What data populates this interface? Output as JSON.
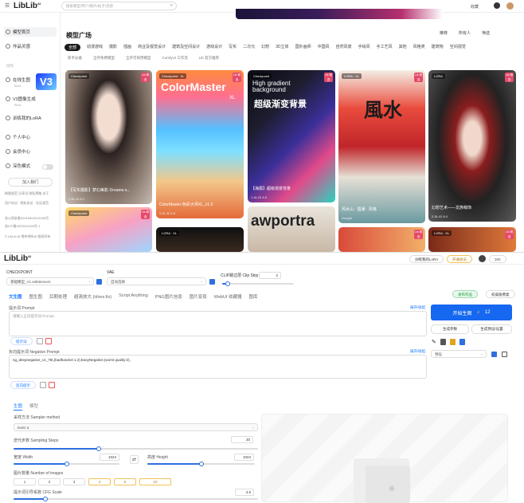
{
  "top": {
    "logo": "LibLib",
    "logo_sup": "AI",
    "search_placeholder": "搜索模型/用户/图片/帖子/灵感",
    "topbar_right": [
      "收藏",
      "登录"
    ],
    "sidebar": {
      "items": [
        {
          "label": "模型首页",
          "active": true
        },
        {
          "label": "作品灵感",
          "active": false
        }
      ],
      "group_label": "创作",
      "create_items": [
        {
          "label": "在线生图",
          "sub": "Beta"
        },
        {
          "label": "V3图像生成",
          "sub": "Beta"
        },
        {
          "label": "训练我的LoRA",
          "sub": ""
        }
      ],
      "user_items": [
        "个人中心",
        "会员中心",
        "深色模式"
      ],
      "join_button": "加入我们",
      "footer_lines": [
        "刷图规范 分享设 隐私策略 关于",
        "用户协议 · 隐私协议 · 社区规范",
        "浙公网安备33010602012345号",
        "浙ICP备2023012345号-1",
        "© LibLib AI 哩布哩布AI 版权所有"
      ],
      "v3_label": "V3"
    },
    "section_title": "模型广场",
    "tabs": [
      "全部",
      "动漫游戏",
      "摄影",
      "插画",
      "商业及视觉设计",
      "建筑及空间设计",
      "游戏设计",
      "写实",
      "二次元",
      "幻想",
      "3D立体",
      "国外画师",
      "中国风",
      "自然风景",
      "手绘风",
      "手工艺风",
      "其他",
      "风格类",
      "建筑物",
      "空间视觉"
    ],
    "filters": [
      "新手必备",
      "全开免费模型",
      "全开可商用模型",
      "ComfyUI 工作流",
      "Lib 官方推荐"
    ],
    "sort": [
      "推荐",
      "所有人",
      "筛选"
    ],
    "cards": [
      {
        "badge": "Checkpoint",
        "title": "【写实摄影】梦幻美影-Dreams-s...",
        "meta": "1.5k  49  5.2"
      },
      {
        "badge": "Checkpoint · XL",
        "title": "ColorMaster-色彩大师XL_v1.0",
        "meta": "2.0k  30  4.8"
      },
      {
        "badge": "Checkpoint",
        "title": "【海报】超级渐变背景",
        "meta": "1.1k  22  4.6"
      },
      {
        "badge": "LORA · XL",
        "title": "风水山 · 国潮 · 风格",
        "meta": "Hongfa"
      },
      {
        "badge": "LORA",
        "title": "幻想艺术——龙族萌饰",
        "meta": "2.2k  41  5.0"
      }
    ],
    "card_overlays": {
      "colormaster": "ColorMaster",
      "colormaster_sub": "XL",
      "gradient_title_en": "High gradient background",
      "gradient_title_cn": "超级渐变背景",
      "feng": "風水",
      "portrait": "awportra",
      "lower_badges": [
        "Checkpoint",
        "LORA · XL",
        "LORA · XL"
      ]
    },
    "lib_badge": "Lib\n精选"
  },
  "bottom": {
    "logo": "LibLib",
    "logo_sup": "AI",
    "header_right": [
      "训练我的LoRA",
      "开通会员",
      "300"
    ],
    "checkpoint_label": "CHECKPOINT",
    "checkpoint_value": "基础模型_V1.safetensors",
    "vae_label": "VAE",
    "vae_value": "自动选择",
    "clip_label": "CLIP跳过层 Clip Skip",
    "clip_value": "2",
    "tabs": [
      "文生图",
      "图生图",
      "后期处理",
      "超清放大 (Hires.fix)",
      "Script Anything",
      "PNG图片信息",
      "图片变现",
      "WebUI 收藏器",
      "图库"
    ],
    "active_tab": 0,
    "prompt_label": "提示词 Prompt",
    "prompt_link": "展开/收起",
    "prompt_placeholder": "请输入正向提示词 Prompt",
    "prompt_assist": "提示词",
    "neg_label": "负向提示词 Negative Prompt",
    "neg_link": "展开/收起",
    "neg_text": "ng_deepnegative_v1_75t,(badhandv4:1.2),EasyNegative,(worst quality:2),",
    "neg_assist": "反向提示",
    "top_right_buttons": [
      "发布作品",
      "权威收费类"
    ],
    "generate_label": "开始生图",
    "generate_count": "12",
    "side_buttons": [
      "生成参数",
      "生成预设/设置"
    ],
    "preset_placeholder": "预设",
    "sub_tabs": [
      "生图",
      "模型"
    ],
    "sampler_label": "采样方法 Sampler method",
    "sampler_value": "Euler a",
    "steps_label": "迭代步数 Sampling Steps",
    "steps_value": "20",
    "steps_fraction": 0.35,
    "width_label": "宽度 Width",
    "width_value": "1024",
    "width_fraction": 0.5,
    "height_label": "高度 Height",
    "height_value": "1024",
    "height_fraction": 0.5,
    "count_label": "图片数量 Number of images",
    "counts": [
      "1",
      "2",
      "3",
      "4",
      "6",
      "10"
    ],
    "cfg_label": "提示词引导系数 CFG Scale",
    "cfg_value": "4.5",
    "accent": "#1668f0"
  }
}
